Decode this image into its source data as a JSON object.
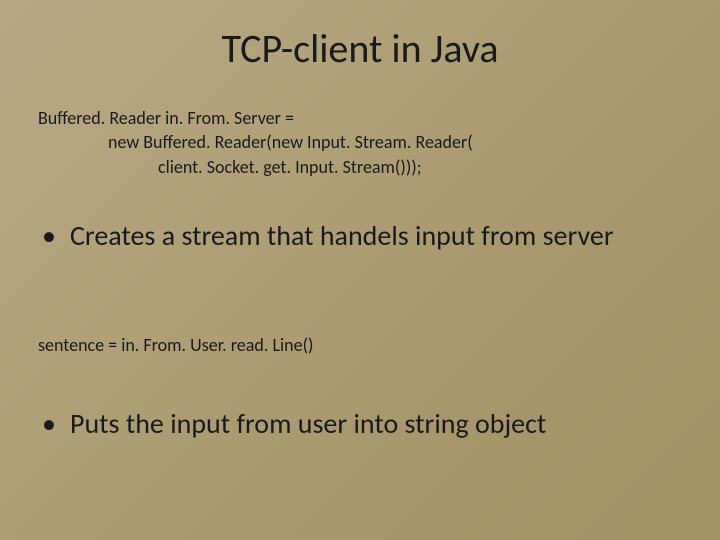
{
  "title": "TCP-client in Java",
  "code1": {
    "line1": "Buffered. Reader in. From. Server =",
    "line2": "new Buffered. Reader(new Input. Stream. Reader(",
    "line3": "client. Socket. get. Input. Stream()));"
  },
  "bullet1": {
    "dot": "•",
    "text": "Creates a stream that handels input from server"
  },
  "code2": {
    "line1": "sentence = in. From. User. read. Line()"
  },
  "bullet2": {
    "dot": "•",
    "text": "Puts the input from user into string object"
  }
}
